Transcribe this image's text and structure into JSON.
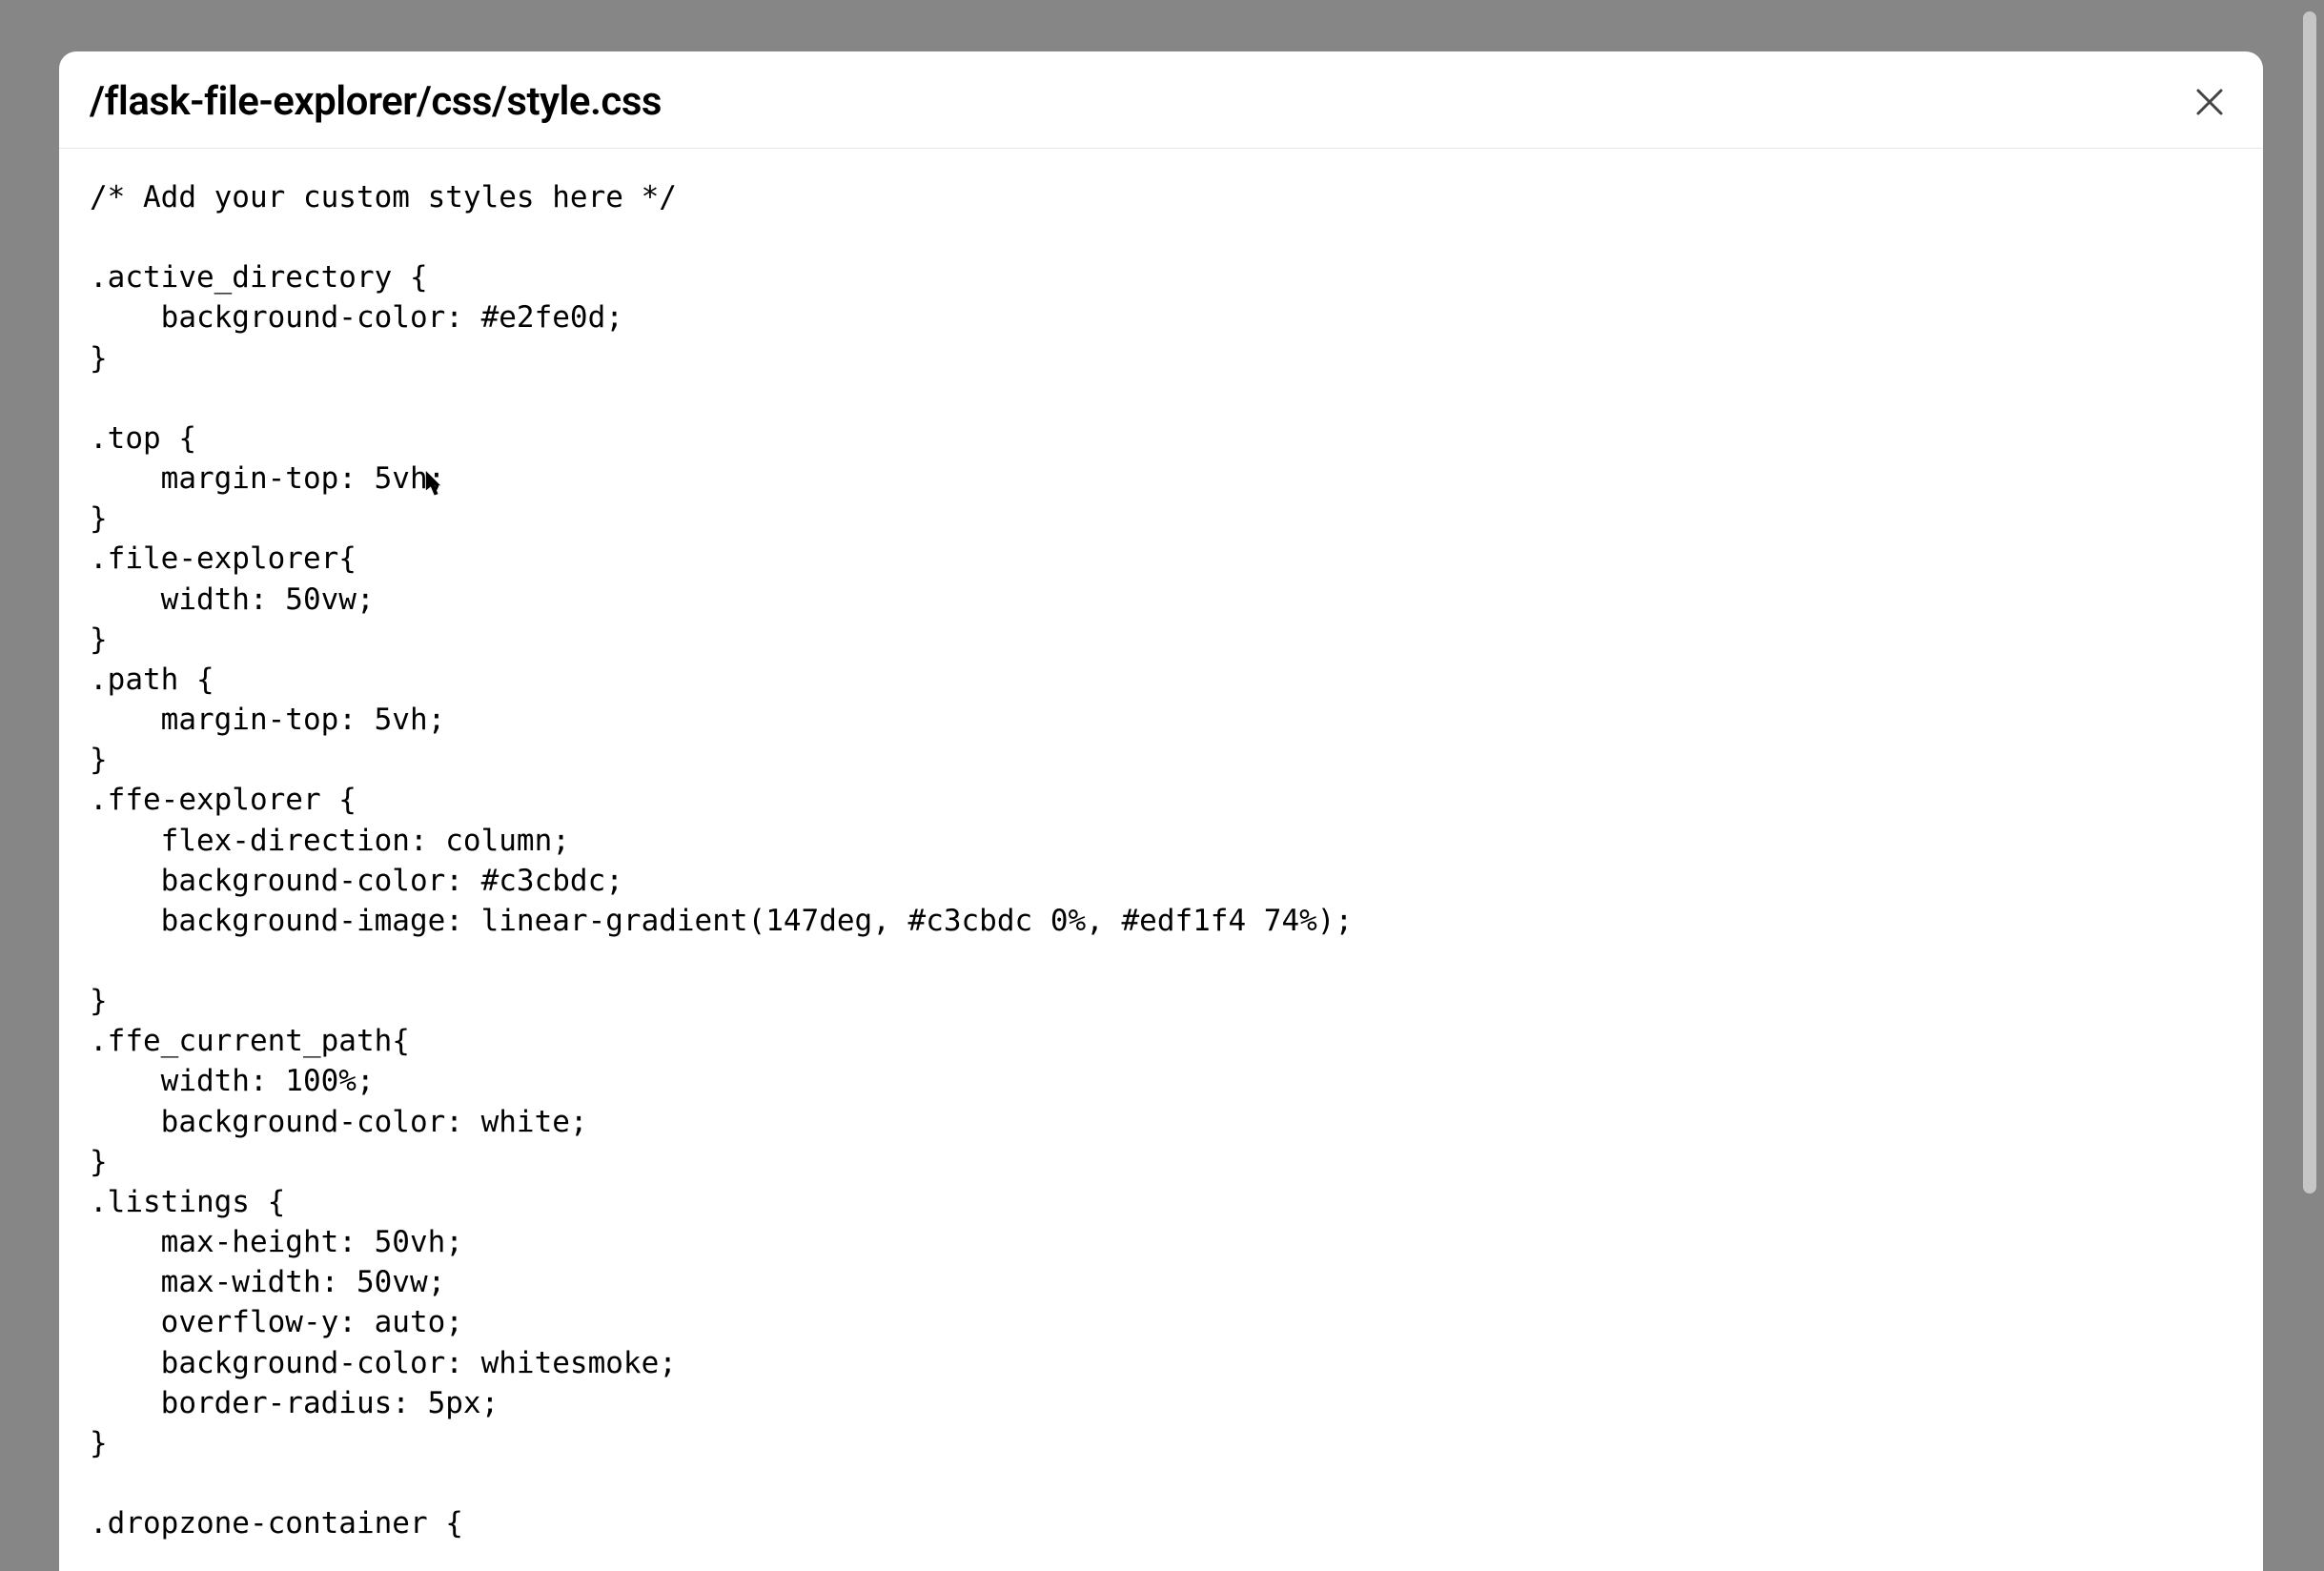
{
  "modal": {
    "title": "/flask-file-explorer/css/style.css",
    "code": "/* Add your custom styles here */\n\n.active_directory {\n    background-color: #e2fe0d;\n}\n\n.top {\n    margin-top: 5vh;\n}\n.file-explorer{\n    width: 50vw;\n}\n.path {\n    margin-top: 5vh;\n}\n.ffe-explorer {\n    flex-direction: column;\n    background-color: #c3cbdc;\n    background-image: linear-gradient(147deg, #c3cbdc 0%, #edf1f4 74%);\n\n}\n.ffe_current_path{\n    width: 100%;\n    background-color: white;\n}\n.listings {\n    max-height: 50vh;\n    max-width: 50vw;\n    overflow-y: auto;\n    background-color: whitesmoke;\n    border-radius: 5px;\n}\n\n.dropzone-container {"
  }
}
